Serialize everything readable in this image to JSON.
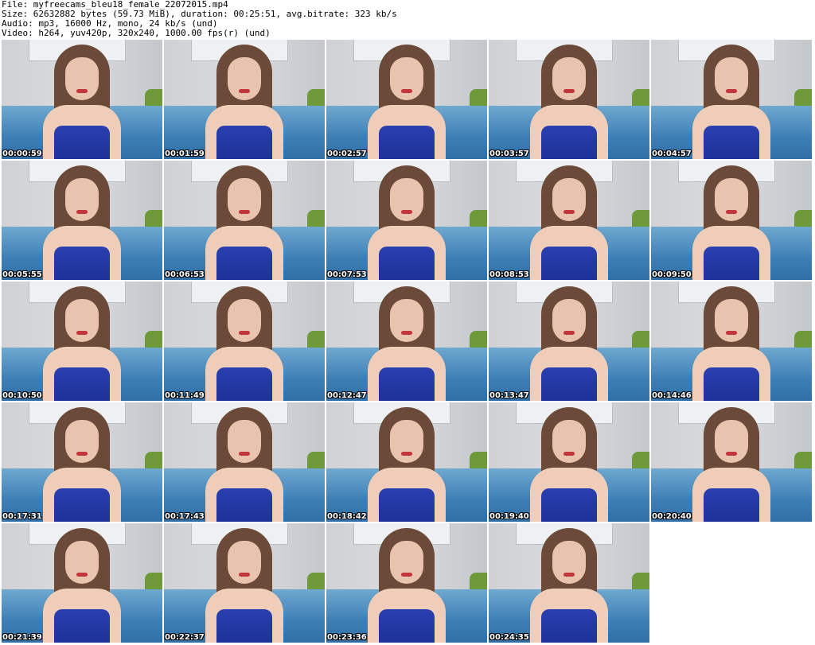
{
  "header": {
    "file": "File: myfreecams_bleu18_female_22072015.mp4",
    "size": "Size: 62632882 bytes (59.73 MiB), duration: 00:25:51, avg.bitrate: 323 kb/s",
    "audio": "Audio: mp3, 16000 Hz, mono, 24 kb/s (und)",
    "video": "Video: h264, yuv420p, 320x240, 1000.00 fps(r) (und)"
  },
  "thumbnails": [
    {
      "timestamp": "00:00:59"
    },
    {
      "timestamp": "00:01:59"
    },
    {
      "timestamp": "00:02:57"
    },
    {
      "timestamp": "00:03:57"
    },
    {
      "timestamp": "00:04:57"
    },
    {
      "timestamp": "00:05:55"
    },
    {
      "timestamp": "00:06:53"
    },
    {
      "timestamp": "00:07:53"
    },
    {
      "timestamp": "00:08:53"
    },
    {
      "timestamp": "00:09:50"
    },
    {
      "timestamp": "00:10:50"
    },
    {
      "timestamp": "00:11:49"
    },
    {
      "timestamp": "00:12:47"
    },
    {
      "timestamp": "00:13:47"
    },
    {
      "timestamp": "00:14:46"
    },
    {
      "timestamp": "00:17:31"
    },
    {
      "timestamp": "00:17:43"
    },
    {
      "timestamp": "00:18:42"
    },
    {
      "timestamp": "00:19:40"
    },
    {
      "timestamp": "00:20:40"
    },
    {
      "timestamp": "00:21:39"
    },
    {
      "timestamp": "00:22:37"
    },
    {
      "timestamp": "00:23:36"
    },
    {
      "timestamp": "00:24:35"
    }
  ]
}
